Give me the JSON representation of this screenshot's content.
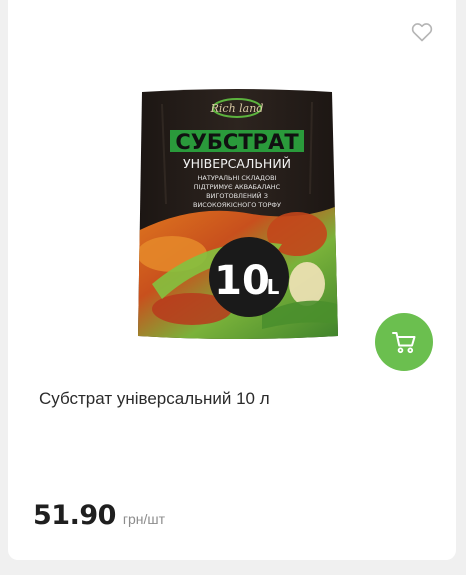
{
  "product": {
    "name": "Субстрат універсальний 10 л",
    "image": {
      "brand_logo": "Rich land",
      "title": "СУБСТРАТ",
      "subtitle": "УНІВЕРСАЛЬНИЙ",
      "line1": "НАТУРАЛЬНІ СКЛАДОВІ",
      "line2": "ПІДТРИМУЄ АКВАБАЛАНС",
      "line3": "ВИГОТОВЛЕНИЙ З",
      "line4": "ВИСОКОЯКІСНОГО ТОРФУ",
      "volume_number": "10",
      "volume_unit": "L"
    },
    "price": "51.90",
    "unit": "грн/шт"
  },
  "icons": {
    "wishlist": "heart-outline-icon",
    "cart": "shopping-cart-icon"
  },
  "colors": {
    "accent_green": "#6bbf4f",
    "package_green": "#2a9a3b",
    "package_dark": "#2a211c"
  }
}
